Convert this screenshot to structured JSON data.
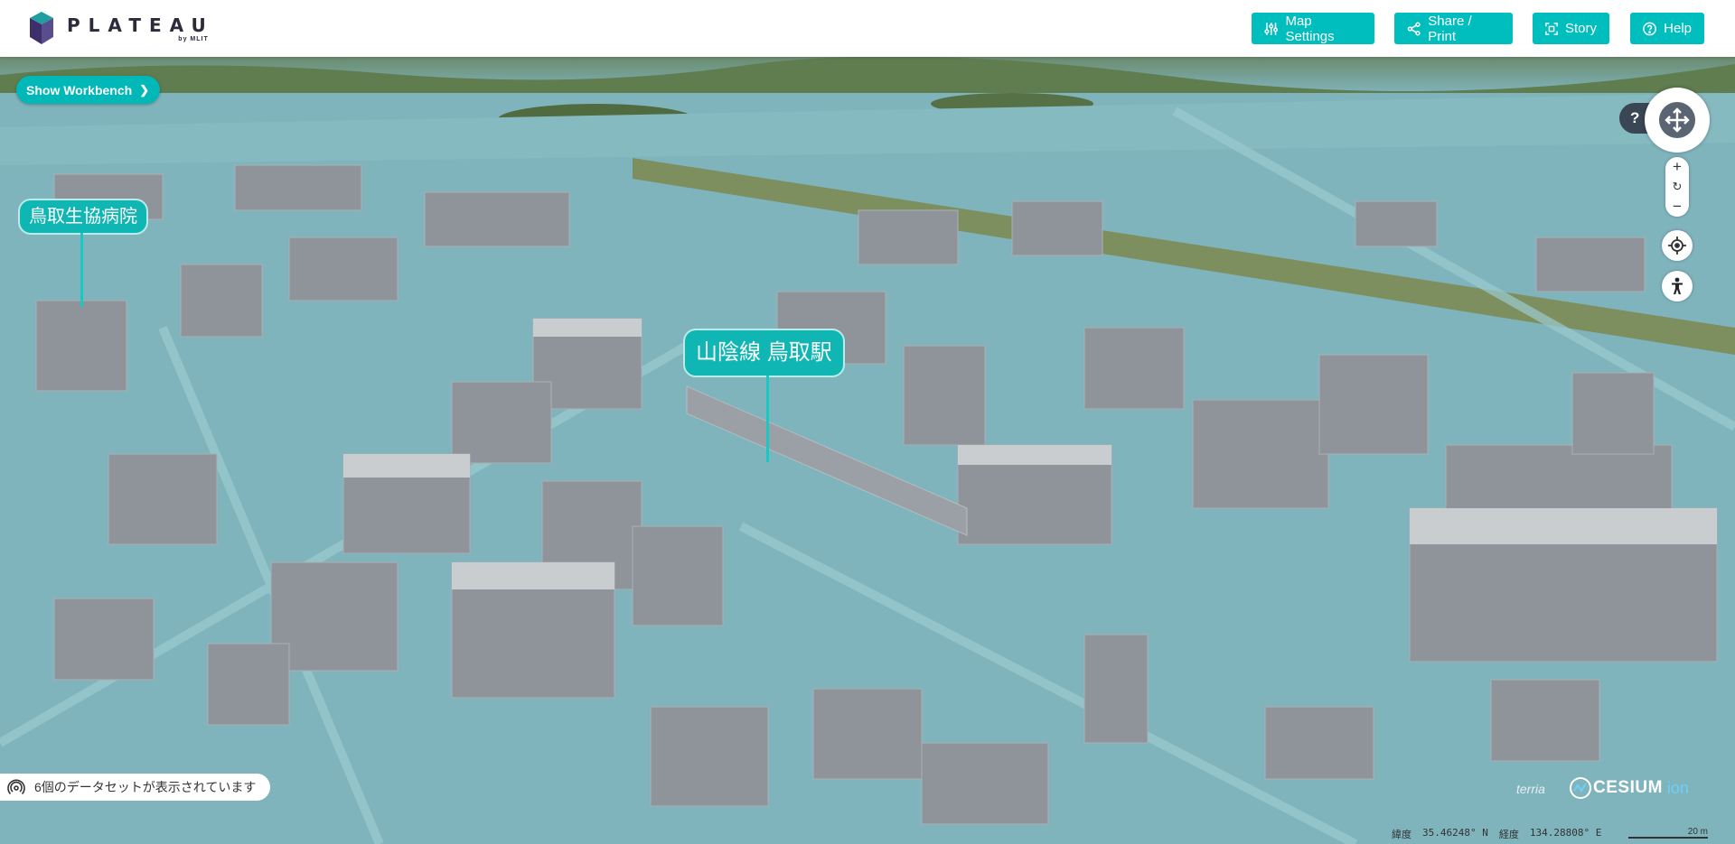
{
  "app": {
    "logo_text": "PLATEAU",
    "logo_by": "by MLIT"
  },
  "toolbar": {
    "map_settings_label": "Map Settings",
    "share_print_label": "Share / Print",
    "story_label": "Story",
    "help_label": "Help"
  },
  "workbench": {
    "show_label": "Show Workbench"
  },
  "map_labels": {
    "hospital": "鳥取生協病院",
    "station": "山陰線 鳥取駅"
  },
  "navigation": {
    "help_glyph": "?",
    "zoom_in": "+",
    "zoom_reset": "↻",
    "zoom_out": "−"
  },
  "status": {
    "datasets_text": "6個のデータセットが表示されています"
  },
  "credits": {
    "terria": "terria",
    "cesium": "CESIUM",
    "ion": "ion"
  },
  "coordinates": {
    "lat_label": "緯度",
    "lat_value": "35.46248° N",
    "lon_label": "経度",
    "lon_value": "134.28808° E"
  },
  "scale": {
    "value": "20 m"
  },
  "colors": {
    "accent": "#00bebe",
    "building": "#8e9499",
    "ground": "#7fb0b8"
  }
}
